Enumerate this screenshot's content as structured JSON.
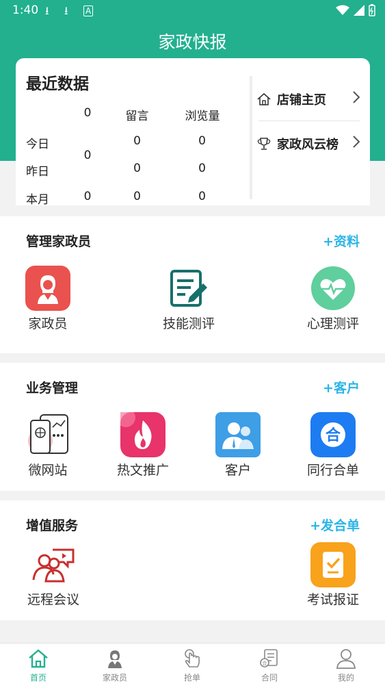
{
  "status_bar": {
    "time": "1:40"
  },
  "header": {
    "title": "家政快报"
  },
  "recent_data": {
    "title": "最近数据",
    "columns": [
      "0",
      "留言",
      "浏览量"
    ],
    "rows": [
      {
        "label": "今日",
        "values": [
          "",
          "0",
          "0"
        ]
      },
      {
        "label": "昨日",
        "values": [
          "",
          "0",
          "0"
        ]
      },
      {
        "label": "本月",
        "values": [
          "0",
          "0",
          "0"
        ]
      }
    ],
    "merged_value": "0",
    "links": [
      {
        "label": "店铺主页",
        "icon": "home-icon"
      },
      {
        "label": "家政风云榜",
        "icon": "trophy-icon"
      }
    ]
  },
  "manage_section": {
    "title": "管理家政员",
    "action": "+资料",
    "items": [
      {
        "label": "家政员",
        "icon": "housekeeper-icon"
      },
      {
        "label": "技能测评",
        "icon": "edit-doc-icon"
      },
      {
        "label": "心理测评",
        "icon": "heart-icon"
      }
    ]
  },
  "business_section": {
    "title": "业务管理",
    "action": "+客户",
    "items": [
      {
        "label": "微网站",
        "icon": "microsite-icon"
      },
      {
        "label": "热文推广",
        "icon": "fire-icon"
      },
      {
        "label": "客户",
        "icon": "customer-icon"
      },
      {
        "label": "同行合单",
        "icon": "merge-icon"
      }
    ]
  },
  "value_section": {
    "title": "增值服务",
    "action": "+发合单",
    "items": [
      {
        "label": "远程会议",
        "icon": "meeting-icon"
      },
      {
        "label": "考试报证",
        "icon": "exam-icon"
      }
    ]
  },
  "tabs": [
    {
      "label": "首页",
      "icon": "home-icon",
      "active": true
    },
    {
      "label": "家政员",
      "icon": "housekeeper-icon",
      "active": false
    },
    {
      "label": "抢单",
      "icon": "tap-icon",
      "active": false
    },
    {
      "label": "合同",
      "icon": "contract-icon",
      "active": false
    },
    {
      "label": "我的",
      "icon": "profile-icon",
      "active": false
    }
  ],
  "colors": {
    "primary": "#22b08f",
    "accent": "#2bb5e8"
  }
}
